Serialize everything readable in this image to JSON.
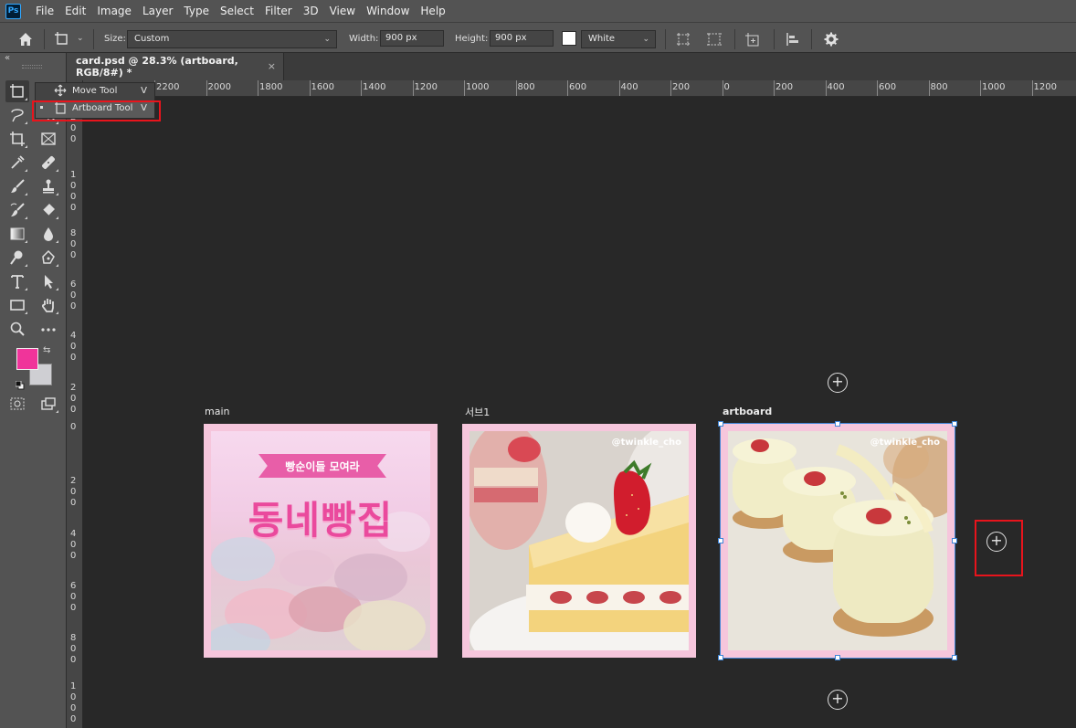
{
  "app": {
    "logo_text": "Ps"
  },
  "menu": [
    "File",
    "Edit",
    "Image",
    "Layer",
    "Type",
    "Select",
    "Filter",
    "3D",
    "View",
    "Window",
    "Help"
  ],
  "options": {
    "size_label": "Size:",
    "size_value": "Custom",
    "width_label": "Width:",
    "width_value": "900 px",
    "height_label": "Height:",
    "height_value": "900 px",
    "background_swatch_color": "#ffffff",
    "background_value": "White"
  },
  "document_tab": {
    "title": "card.psd @ 28.3% (artboard, RGB/8#) *",
    "close": "×"
  },
  "flyout": {
    "items": [
      {
        "label": "Move Tool",
        "shortcut": "V",
        "icon": "move-icon"
      },
      {
        "label": "Artboard Tool",
        "shortcut": "V",
        "icon": "artboard-icon",
        "active": true
      }
    ]
  },
  "colors": {
    "foreground": "#f0349a",
    "background": "#cfcfd3",
    "highlight": "#e8141c",
    "selection": "#3f86d8"
  },
  "ruler_top": [
    "2200",
    "2000",
    "1800",
    "1600",
    "1400",
    "1200",
    "1000",
    "800",
    "600",
    "400",
    "200",
    "0",
    "200",
    "400",
    "600",
    "800",
    "1000",
    "1200"
  ],
  "ruler_left_groups": [
    [
      "1",
      "2",
      "0",
      "0"
    ],
    [
      "1",
      "0",
      "0",
      "0"
    ],
    [
      "8",
      "0",
      "0"
    ],
    [
      "6",
      "0",
      "0"
    ],
    [
      "4",
      "0",
      "0"
    ],
    [
      "2",
      "0",
      "0"
    ],
    [
      "0"
    ],
    [
      "2",
      "0",
      "0"
    ],
    [
      "4",
      "0",
      "0"
    ],
    [
      "6",
      "0",
      "0"
    ],
    [
      "8",
      "0",
      "0"
    ],
    [
      "1",
      "0",
      "0",
      "0"
    ]
  ],
  "artboards": [
    {
      "label": "main",
      "banner": "빵순이들 모여라",
      "headline": "동네빵집"
    },
    {
      "label": "서브1",
      "watermark": "@twinkle_cho"
    },
    {
      "label": "artboard",
      "watermark": "@twinkle_cho"
    }
  ],
  "add_artboard_symbol": "+"
}
